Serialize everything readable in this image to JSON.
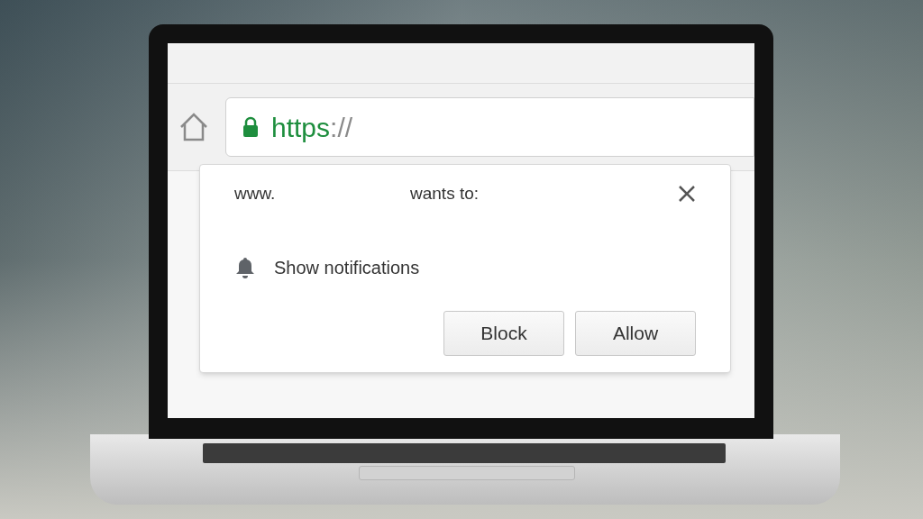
{
  "address_bar": {
    "scheme": "https",
    "separator": "://"
  },
  "permission_prompt": {
    "site": "www.",
    "request": "wants to:",
    "permission": "Show notifications",
    "buttons": [
      {
        "label": "Block"
      },
      {
        "label": "Allow"
      }
    ]
  }
}
